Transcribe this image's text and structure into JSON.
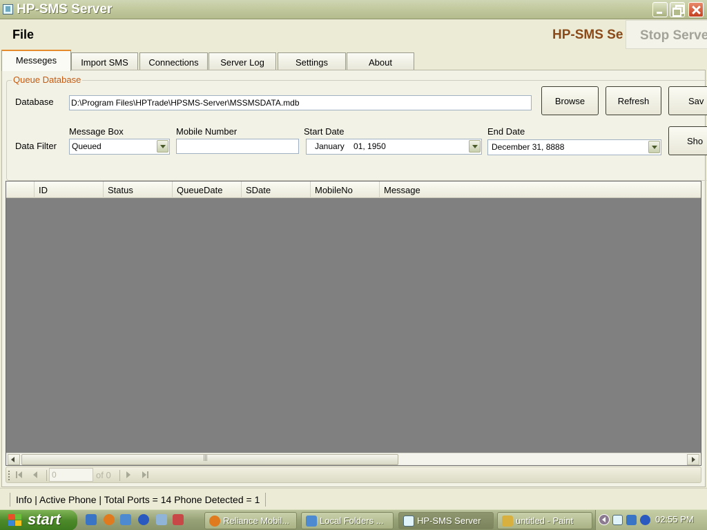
{
  "window": {
    "title": "HP-SMS Server"
  },
  "menu": {
    "file": "File",
    "brand": "HP-SMS Se",
    "stop_button": "Stop Serve"
  },
  "tabs": [
    {
      "label": "Messeges",
      "active": true
    },
    {
      "label": "Import SMS"
    },
    {
      "label": "Connections"
    },
    {
      "label": "Server Log"
    },
    {
      "label": "Settings"
    },
    {
      "label": "About"
    }
  ],
  "queue": {
    "group_title": "Queue Database",
    "database_label": "Database",
    "database_value": "D:\\Program Files\\HPTrade\\HPSMS-Server\\MSSMSDATA.mdb",
    "browse": "Browse",
    "refresh": "Refresh",
    "save": "Sav",
    "data_filter_label": "Data Filter",
    "message_box_label": "Message Box",
    "message_box_value": "Queued",
    "mobile_number_label": "Mobile Number",
    "mobile_number_value": "",
    "start_date_label": "Start Date",
    "start_date_value": "January    01, 1950",
    "end_date_label": "End Date",
    "end_date_value": "December 31, 8888",
    "show": "Sho"
  },
  "grid": {
    "columns": [
      "ID",
      "Status",
      "QueueDate",
      "SDate",
      "MobileNo",
      "Message"
    ],
    "rows": []
  },
  "navigator": {
    "position": "0",
    "count": "of 0"
  },
  "status": {
    "text": "Info | Active Phone | Total Ports = 14 Phone Detected = 1"
  },
  "taskbar": {
    "start": "start",
    "tasks": [
      {
        "label": "Reliance Mobil..."
      },
      {
        "label": "Local Folders ..."
      },
      {
        "label": "HP-SMS Server",
        "active": true
      },
      {
        "label": "untitled - Paint"
      }
    ],
    "clock": "02:55 PM"
  },
  "colors": {
    "accent": "#e68b2c",
    "group_title": "#c45a10",
    "brand": "#8a4a1a",
    "grid_bg": "#808080"
  },
  "icons": [
    "app-icon",
    "minimize-icon",
    "maximize-icon",
    "close-icon",
    "chevron-down-icon",
    "scroll-left-icon",
    "scroll-right-icon",
    "nav-first-icon",
    "nav-prev-icon",
    "nav-next-icon",
    "nav-last-icon",
    "windows-logo-icon"
  ]
}
